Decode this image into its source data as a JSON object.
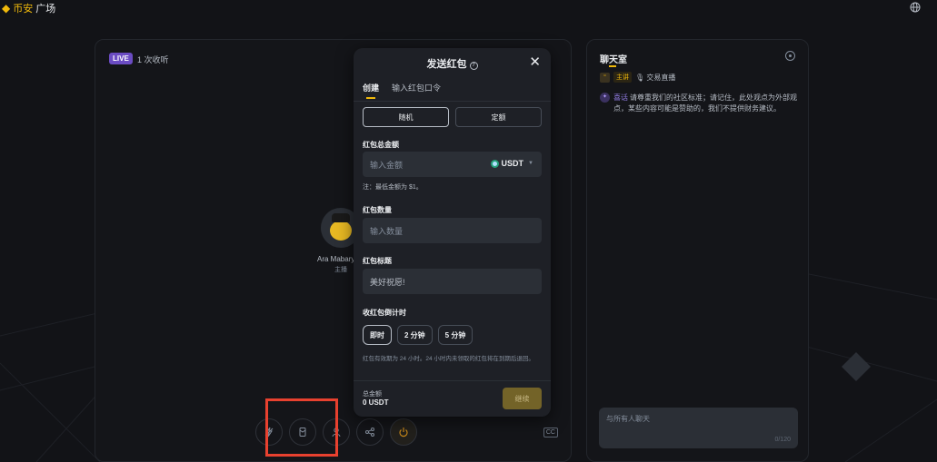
{
  "app": {
    "logo_mark": "◆",
    "brand": "币安",
    "name": "广场"
  },
  "stream": {
    "live_badge": "LIVE",
    "viewers": "1 次收听",
    "host_name": "Ara Mabary zo",
    "host_role": "主播",
    "cc_label": "CC"
  },
  "controls": [
    "lightning-icon",
    "red-packet-icon",
    "user-icon",
    "share-icon",
    "power-icon"
  ],
  "chat": {
    "title": "聊天室",
    "host_tag": "主讲",
    "topic": "🎙 交易直播",
    "notice_tag": "喜话",
    "notice_text": "请尊重我们的社区标准；请记住，此处观点为外部观点，某些内容可能是赞助的，我们不提供财务建议。",
    "input_placeholder": "与所有人聊天",
    "char_count": "0/120"
  },
  "modal": {
    "title": "发送红包",
    "close": "✕",
    "help": "?",
    "tabs": [
      "创建",
      "输入红包口令"
    ],
    "type_options": [
      "随机",
      "定额"
    ],
    "amount_label": "红包总金额",
    "amount_placeholder": "输入金额",
    "currency": "USDT",
    "min_note": "注：最低金额为 $1。",
    "count_label": "红包数量",
    "count_placeholder": "输入数量",
    "title_label": "红包标题",
    "title_value": "美好祝愿!",
    "timer_label": "收红包倒计时",
    "timer_options": [
      "即时",
      "2 分钟",
      "5 分钟"
    ],
    "expiry_note": "红包有效期为 24 小时。24 小时内未领取的红包将在到期后退回。",
    "total_label": "总金额",
    "total_value": "0 USDT",
    "continue_label": "继续"
  }
}
